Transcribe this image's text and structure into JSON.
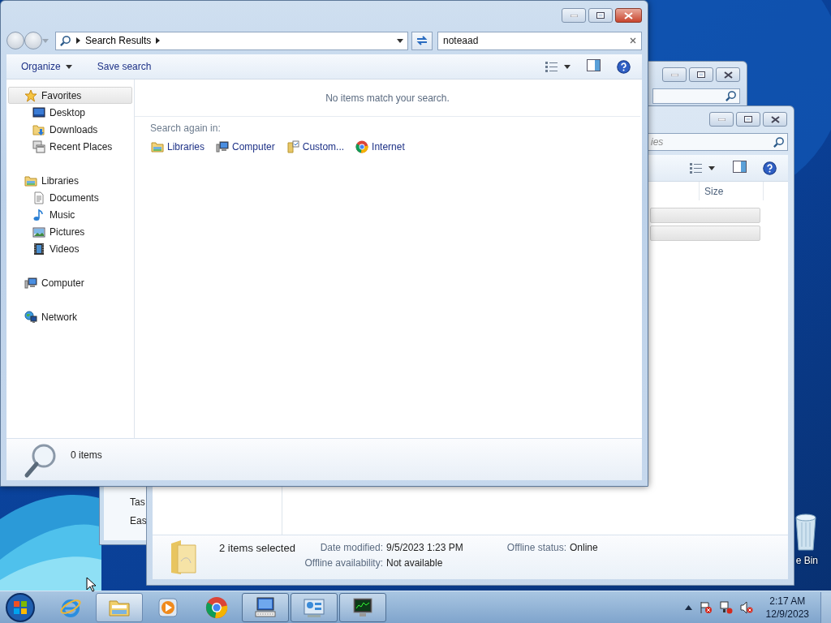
{
  "desktop": {
    "recycle_bin_label": "e Bin"
  },
  "rear_window": {
    "items": [
      "Tas",
      "Eas"
    ]
  },
  "back_window": {
    "search_placeholder": "ies",
    "columns": [
      "Size"
    ],
    "rows": [
      {
        "selected": true
      },
      {
        "selected": true
      }
    ],
    "details": {
      "summary": "2 items selected",
      "fields": [
        {
          "label": "Date modified:",
          "value": "9/5/2023 1:23 PM"
        },
        {
          "label": "Offline status:",
          "value": "Online"
        },
        {
          "label": "Offline availability:",
          "value": "Not available"
        }
      ]
    }
  },
  "search_window": {
    "address": [
      "Search Results"
    ],
    "search": {
      "value": "noteaad"
    },
    "toolbar": [
      "Organize",
      "Save search"
    ],
    "nav": [
      {
        "label": "Favorites",
        "kind": "star",
        "selected": true,
        "children": [
          {
            "label": "Desktop",
            "kind": "desktop",
            "selected": false
          },
          {
            "label": "Downloads",
            "kind": "downloads",
            "selected": false
          },
          {
            "label": "Recent Places",
            "kind": "recent",
            "selected": false
          }
        ]
      },
      {
        "label": "Libraries",
        "kind": "library",
        "selected": false,
        "children": [
          {
            "label": "Documents",
            "kind": "document",
            "selected": false
          },
          {
            "label": "Music",
            "kind": "music",
            "selected": false
          },
          {
            "label": "Pictures",
            "kind": "pictures",
            "selected": false
          },
          {
            "label": "Videos",
            "kind": "videos",
            "selected": false
          }
        ]
      },
      {
        "label": "Computer",
        "kind": "computer",
        "selected": false
      },
      {
        "label": "Network",
        "kind": "network",
        "selected": false
      }
    ],
    "message": "No items match your search.",
    "search_again": {
      "label": "Search again in:",
      "locations": [
        {
          "label": "Libraries",
          "kind": "library"
        },
        {
          "label": "Computer",
          "kind": "computer"
        },
        {
          "label": "Custom...",
          "kind": "custom"
        },
        {
          "label": "Internet",
          "kind": "chrome"
        }
      ]
    },
    "status": "0 items"
  },
  "taskbar": {
    "apps": [
      {
        "kind": "ie",
        "running": false,
        "selected": false
      },
      {
        "kind": "explorer",
        "running": true,
        "selected": true
      },
      {
        "kind": "media",
        "running": false,
        "selected": false
      },
      {
        "kind": "chrome",
        "running": false,
        "selected": false
      },
      {
        "kind": "keyboard",
        "running": true,
        "selected": false
      },
      {
        "kind": "control",
        "running": true,
        "selected": false
      },
      {
        "kind": "monitor",
        "running": true,
        "selected": false
      }
    ],
    "clock": {
      "time": "2:17 AM",
      "date": "12/9/2023"
    }
  }
}
